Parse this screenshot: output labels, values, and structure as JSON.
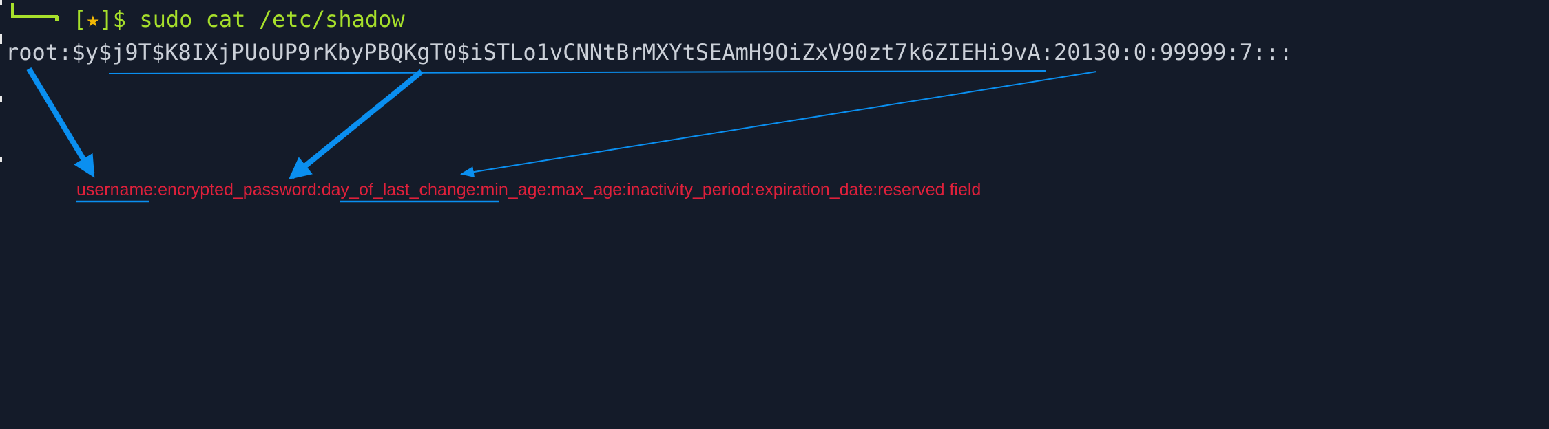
{
  "terminal": {
    "prompt_open": "[",
    "prompt_star": "★",
    "prompt_close": "]$ ",
    "command": "sudo cat /etc/shadow",
    "output_line": "root:$y$j9T$K8IXjPUoUP9rKbyPBQKgT0$iSTLo1vCNNtBrMXYtSEAmH9OiZxV90zt7k6ZIEHi9vA:20130:0:99999:7:::"
  },
  "annotation": {
    "fields_label": "username:encrypted_password:day_of_last_change:min_age:max_age:inactivity_period:expiration_date:reserved field",
    "arrow_color": "#0a8ff0",
    "label_color": "#e0203b"
  },
  "colors": {
    "background": "#141b29",
    "prompt": "#a7e02b",
    "star": "#f2b705",
    "output_text": "#cbd0d8"
  }
}
